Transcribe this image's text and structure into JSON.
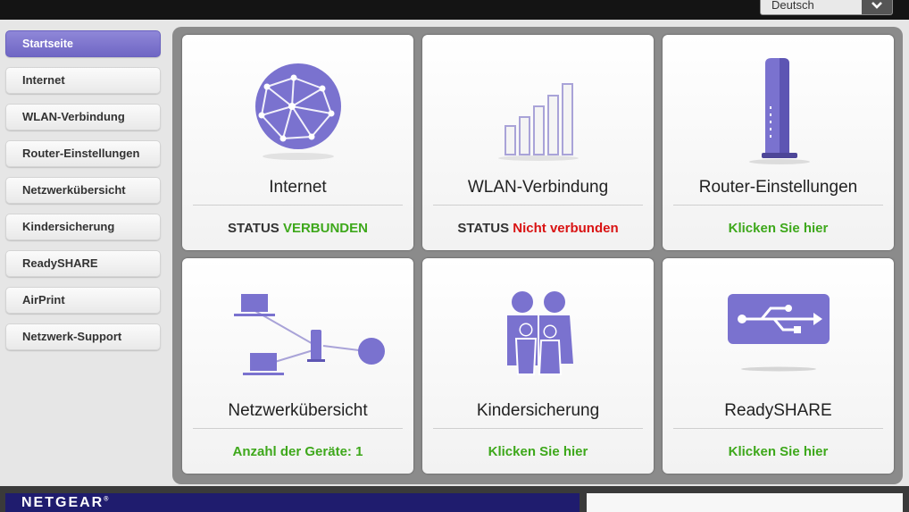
{
  "header": {
    "language": "Deutsch"
  },
  "sidebar": {
    "items": [
      {
        "label": "Startseite"
      },
      {
        "label": "Internet"
      },
      {
        "label": "WLAN-Verbindung"
      },
      {
        "label": "Router-Einstellungen"
      },
      {
        "label": "Netzwerkübersicht"
      },
      {
        "label": "Kindersicherung"
      },
      {
        "label": "ReadySHARE"
      },
      {
        "label": "AirPrint"
      },
      {
        "label": "Netzwerk-Support"
      }
    ]
  },
  "tiles": {
    "internet": {
      "title": "Internet",
      "status_prefix": "STATUS",
      "status_value": "VERBUNDEN"
    },
    "wlan": {
      "title": "WLAN-Verbindung",
      "status_prefix": "STATUS",
      "status_value": "Nicht verbunden"
    },
    "router": {
      "title": "Router-Einstellungen",
      "link": "Klicken Sie hier"
    },
    "network": {
      "title": "Netzwerkübersicht",
      "device_count_text": "Anzahl der Geräte: 1"
    },
    "parental": {
      "title": "Kindersicherung",
      "link": "Klicken Sie hier"
    },
    "readyshare": {
      "title": "ReadySHARE",
      "link": "Klicken Sie hier"
    }
  },
  "footer": {
    "brand": "NETGEAR",
    "brand_mark": "®"
  },
  "colors": {
    "accent": "#7a72cf",
    "status_ok": "#3ea81b",
    "status_error": "#d91313",
    "brand_bar": "#1f1c6e"
  }
}
